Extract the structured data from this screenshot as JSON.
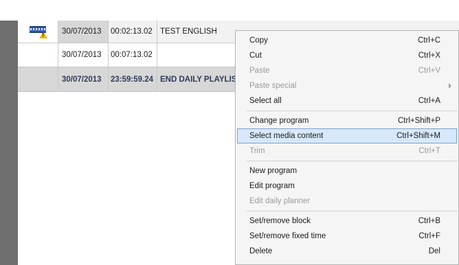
{
  "grid": {
    "rows": [
      {
        "date": "30/07/2013",
        "time": "00:02:13.02",
        "title": "TEST ENGLISH",
        "icon": "film-warning-icon"
      },
      {
        "date": "30/07/2013",
        "time": "00:07:13.02",
        "title": ""
      },
      {
        "date": "30/07/2013",
        "time": "23:59:59.24",
        "title": "END DAILY PLAYLIST"
      }
    ]
  },
  "context_menu": {
    "items": [
      {
        "label": "Copy",
        "shortcut": "Ctrl+C",
        "enabled": true
      },
      {
        "label": "Cut",
        "shortcut": "Ctrl+X",
        "enabled": true
      },
      {
        "label": "Paste",
        "shortcut": "Ctrl+V",
        "enabled": false
      },
      {
        "label": "Paste special",
        "shortcut": "",
        "enabled": false,
        "submenu": true
      },
      {
        "label": "Select all",
        "shortcut": "Ctrl+A",
        "enabled": true
      },
      {
        "label": "Change program",
        "shortcut": "Ctrl+Shift+P",
        "enabled": true
      },
      {
        "label": "Select media content",
        "shortcut": "Ctrl+Shift+M",
        "enabled": true,
        "highlighted": true
      },
      {
        "label": "Trim",
        "shortcut": "Ctrl+T",
        "enabled": false
      },
      {
        "label": "New program",
        "shortcut": "",
        "enabled": true
      },
      {
        "label": "Edit program",
        "shortcut": "",
        "enabled": true
      },
      {
        "label": "Edit daily planner",
        "shortcut": "",
        "enabled": false
      },
      {
        "label": "Set/remove block",
        "shortcut": "Ctrl+B",
        "enabled": true
      },
      {
        "label": "Set/remove fixed time",
        "shortcut": "Ctrl+F",
        "enabled": true
      },
      {
        "label": "Delete",
        "shortcut": "Del",
        "enabled": true
      }
    ]
  },
  "colors": {
    "highlight_bg": "#d8e8fb",
    "highlight_border": "#7da2ce",
    "selected_row_bg": "#d7d7d7",
    "bold_row_text": "#2f3b57"
  }
}
